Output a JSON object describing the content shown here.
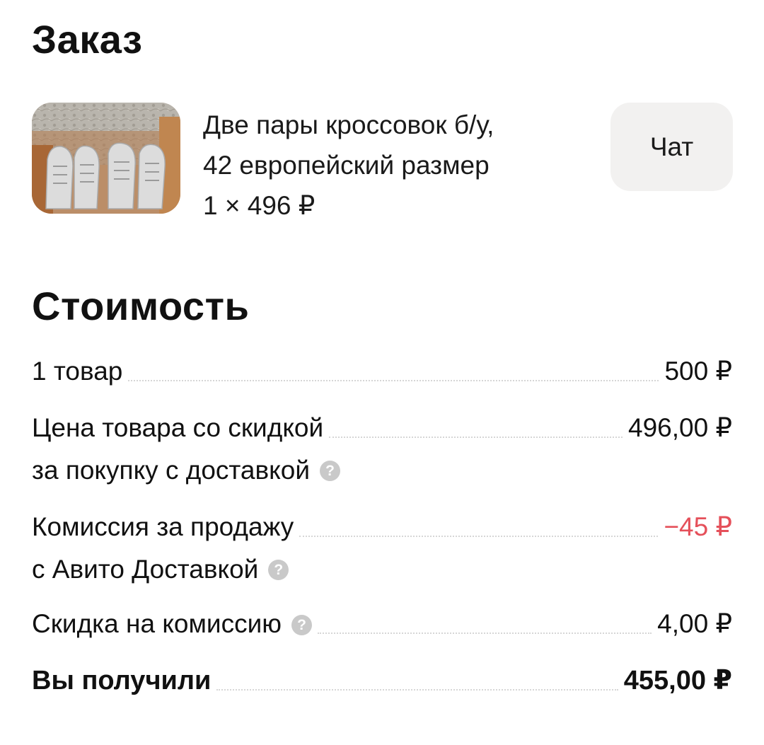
{
  "order": {
    "title": "Заказ",
    "product_line1": "Две пары кроссовок б/у,",
    "product_line2": "42 европейский размер",
    "product_price": "1 × 496 ₽",
    "thumbnail_icon": "sneakers-photo",
    "chat_label": "Чат"
  },
  "cost": {
    "title": "Стоимость",
    "rows": [
      {
        "label": "1 товар",
        "label2": "",
        "value": "500 ₽",
        "help": false
      },
      {
        "label": "Цена товара со скидкой",
        "label2": "за покупку с доставкой",
        "value": "496,00 ₽",
        "help": true
      },
      {
        "label": "Комиссия за продажу",
        "label2": "с Авито Доставкой",
        "value": "−45 ₽",
        "help": true
      },
      {
        "label": "Скидка на комиссию",
        "label2": "",
        "value": "4,00 ₽",
        "help": true
      },
      {
        "label": "Вы получили",
        "label2": "",
        "value": "455,00 ₽",
        "help": false
      }
    ],
    "help_glyph": "?"
  },
  "colors": {
    "negative": "#e5505a",
    "chat_button_bg": "#f2f1f0",
    "help_icon_bg": "#c9c9c9"
  }
}
